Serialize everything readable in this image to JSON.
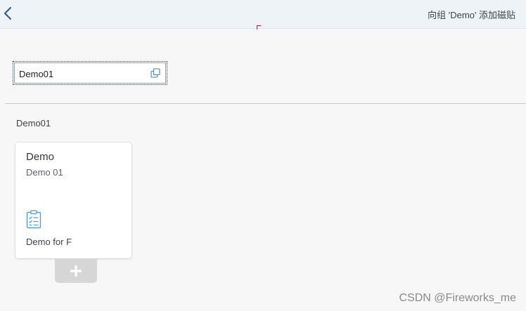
{
  "header": {
    "title": "向组 'Demo' 添加磁贴",
    "back_icon": "chevron-left-icon"
  },
  "search": {
    "value": "Demo01",
    "icon": "open-in-new-window-icon"
  },
  "group": {
    "label": "Demo01"
  },
  "tile": {
    "title": "Demo",
    "subtitle": "Demo 01",
    "icon": "clipboard-task-list-icon",
    "footer": "Demo for F"
  },
  "add_tile": {
    "icon": "plus-icon"
  },
  "watermark": "CSDN @Fireworks_me",
  "colors": {
    "header_bg": "#eef3f8",
    "page_bg": "#f7f7f7",
    "accent": "#0a6ed1",
    "icon_blue": "#5b9bd5",
    "add_tile_bg": "#d6d6d6"
  }
}
